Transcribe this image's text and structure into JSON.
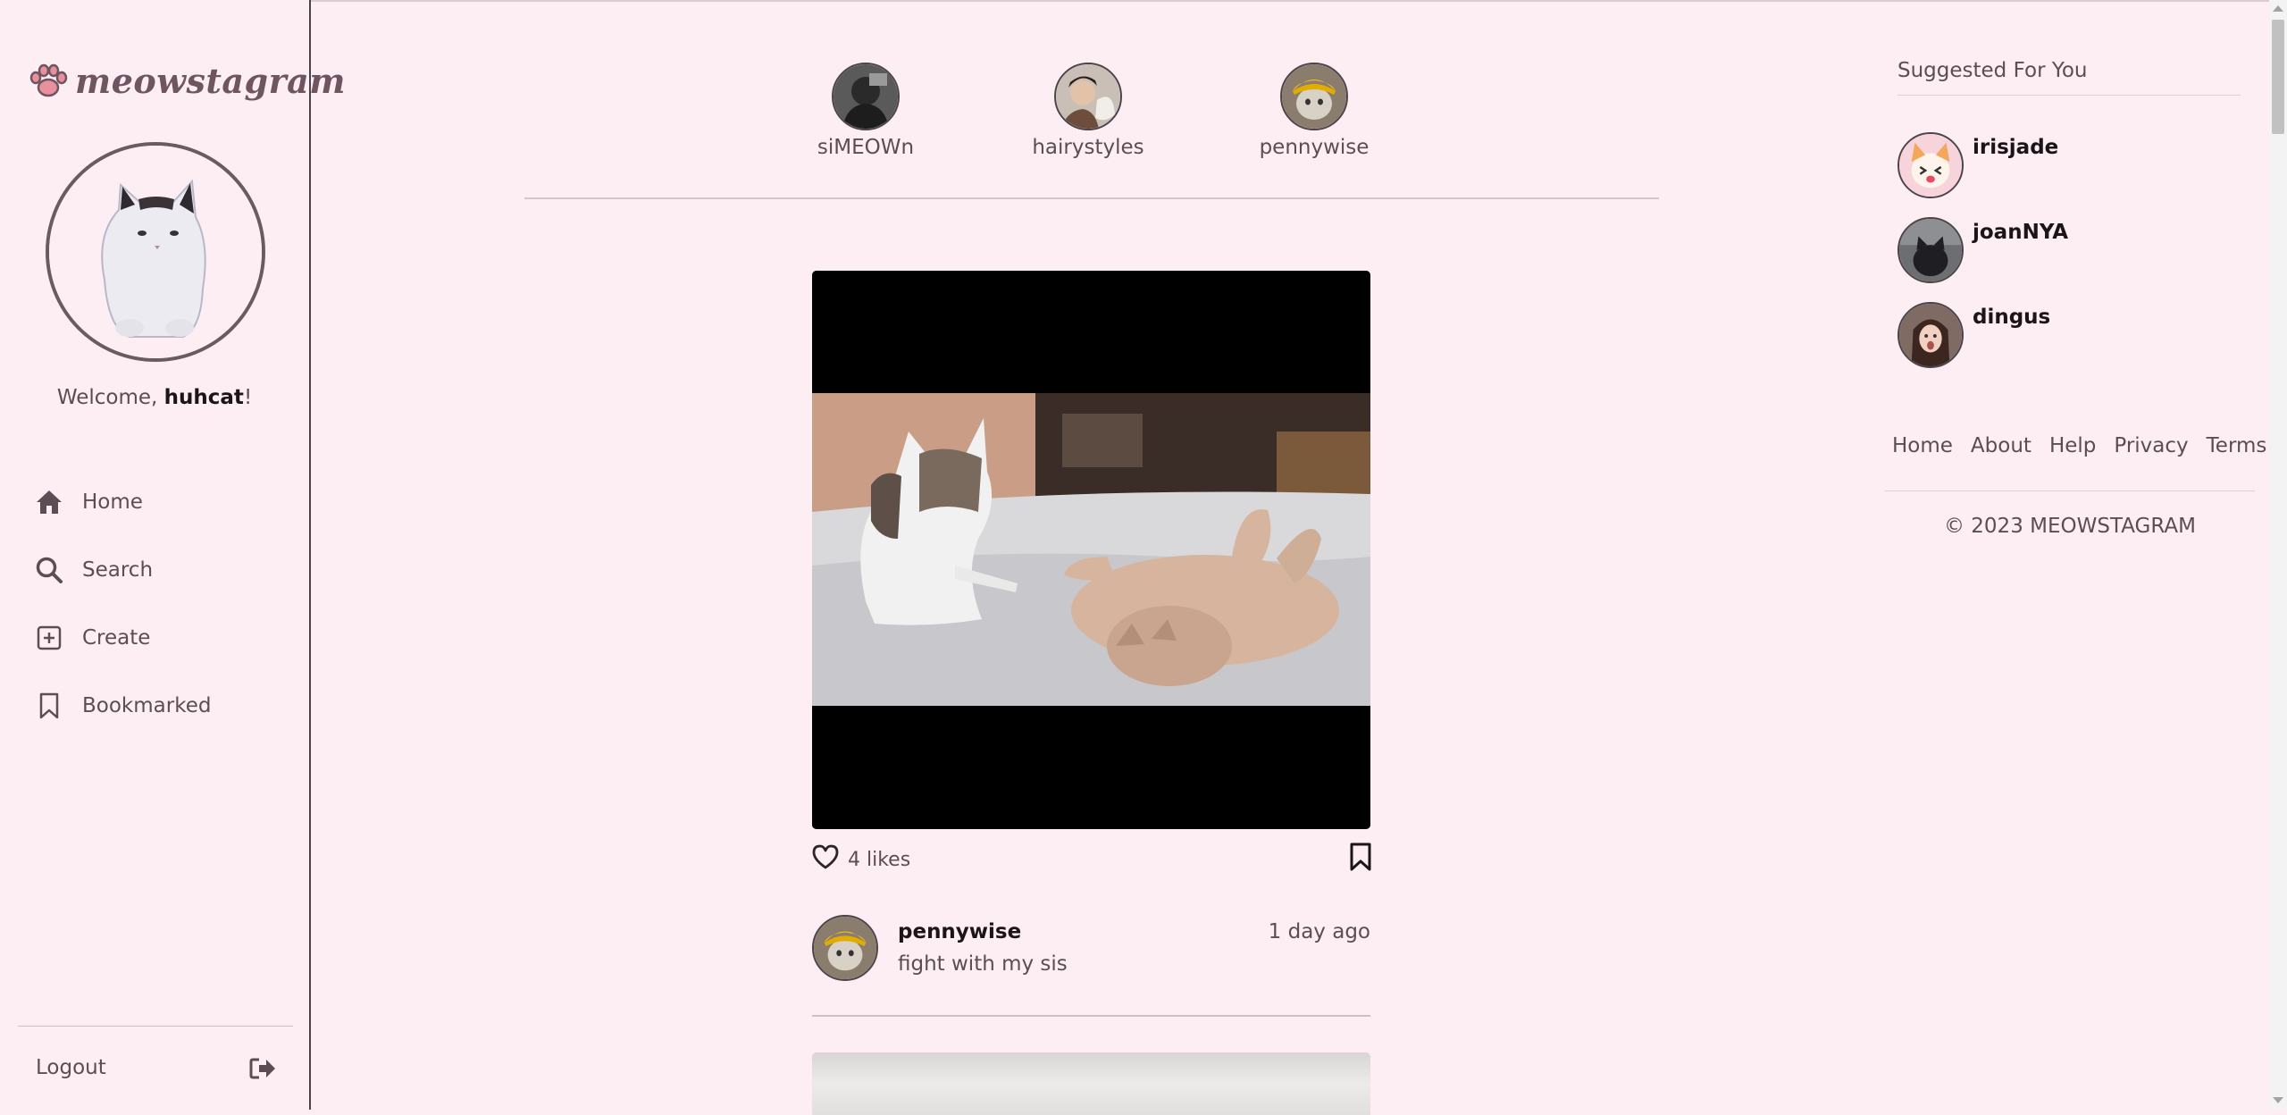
{
  "brand": {
    "name": "meowstagram",
    "logo_icon": "paw-icon"
  },
  "user": {
    "welcome_prefix": "Welcome, ",
    "username": "huhcat",
    "welcome_suffix": "!"
  },
  "nav": {
    "items": [
      {
        "label": "Home",
        "icon": "home-icon"
      },
      {
        "label": "Search",
        "icon": "search-icon"
      },
      {
        "label": "Create",
        "icon": "plus-square-icon"
      },
      {
        "label": "Bookmarked",
        "icon": "bookmark-icon"
      }
    ],
    "logout_label": "Logout",
    "logout_icon": "logout-icon"
  },
  "stories": [
    {
      "name": "siMEOWn"
    },
    {
      "name": "hairystyles"
    },
    {
      "name": "pennywise"
    }
  ],
  "post": {
    "likes_text": "4 likes",
    "username": "pennywise",
    "time": "1 day ago",
    "caption": "fight with my sis"
  },
  "suggestions": {
    "title": "Suggested For You",
    "users": [
      {
        "name": "irisjade"
      },
      {
        "name": "joanNYA"
      },
      {
        "name": "dingus"
      }
    ]
  },
  "footer": {
    "links": [
      "Home",
      "About",
      "Help",
      "Privacy",
      "Terms"
    ],
    "copyright": "© 2023 MEOWSTAGRAM"
  },
  "colors": {
    "background": "#fdeef3",
    "accent": "#6e5560",
    "text": "#5c4d55",
    "strong_text": "#1b1418"
  }
}
